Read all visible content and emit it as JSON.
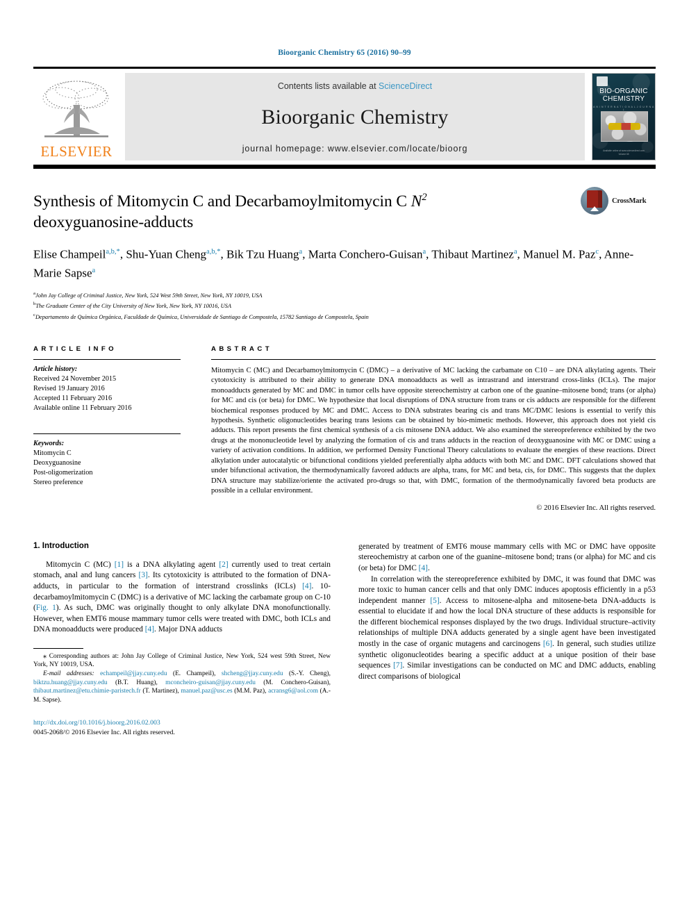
{
  "running_head": "Bioorganic Chemistry 65 (2016) 90–99",
  "masthead": {
    "publisher_logo_label": "ELSEVIER",
    "contents_prefix": "Contents lists available at ",
    "contents_link": "ScienceDirect",
    "journal_title": "Bioorganic Chemistry",
    "homepage_label": "journal homepage: www.elsevier.com/locate/bioorg",
    "cover": {
      "title_line1": "BIO-ORGANIC",
      "title_line2": "CHEMISTRY",
      "subtitle": "A N   I N T E R N A T I O N A L   J O U R N A L",
      "footer_line1": "Available online at www.sciencedirect.com",
      "footer_line2": "Volume 65"
    }
  },
  "article": {
    "title_part1": "Synthesis of Mitomycin C and Decarbamoylmitomycin C ",
    "title_italic": "N",
    "title_sup": "2",
    "title_part2": "deoxyguanosine-adducts",
    "crossmark_label": "CrossMark",
    "authors_line1_a": "Elise Champeil",
    "authors_line1_a_sup": "a,b,*",
    "authors_line1_b": ", Shu-Yuan Cheng",
    "authors_line1_b_sup": "a,b,*",
    "authors_line1_c": ", Bik Tzu Huang",
    "authors_line1_c_sup": "a",
    "authors_line1_d": ", Marta Conchero-Guisan",
    "authors_line1_d_sup": "a",
    "authors_line1_e": ", Thibaut Martinez",
    "authors_line1_e_sup": "a",
    "authors_line2_a": ", Manuel M. Paz",
    "authors_line2_a_sup": "c",
    "authors_line2_b": ", Anne-Marie Sapse",
    "authors_line2_b_sup": "a",
    "affiliations": [
      {
        "marker": "a",
        "text": "John Jay College of Criminal Justice, New York, 524 West 59th Street, New York, NY 10019, USA"
      },
      {
        "marker": "b",
        "text": "The Graduate Center of the City University of New York, New York, NY 10016, USA"
      },
      {
        "marker": "c",
        "text": "Departamento de Química Orgánica, Faculdade de Química, Universidade de Santiago de Compostela, 15782 Santiago de Compostela, Spain"
      }
    ]
  },
  "article_info": {
    "heading": "ARTICLE INFO",
    "history_label": "Article history:",
    "history": [
      "Received 24 November 2015",
      "Revised 19 January 2016",
      "Accepted 11 February 2016",
      "Available online 11 February 2016"
    ],
    "keywords_label": "Keywords:",
    "keywords": [
      "Mitomycin C",
      "Deoxyguanosine",
      "Post-oligomerization",
      "Stereo preference"
    ]
  },
  "abstract": {
    "heading": "ABSTRACT",
    "text": "Mitomycin C (MC) and Decarbamoylmitomycin C (DMC) – a derivative of MC lacking the carbamate on C10 – are DNA alkylating agents. Their cytotoxicity is attributed to their ability to generate DNA monoadducts as well as intrastrand and interstrand cross-links (ICLs). The major monoadducts generated by MC and DMC in tumor cells have opposite stereochemistry at carbon one of the guanine–mitosene bond; trans (or alpha) for MC and cis (or beta) for DMC. We hypothesize that local disruptions of DNA structure from trans or cis adducts are responsible for the different biochemical responses produced by MC and DMC. Access to DNA substrates bearing cis and trans MC/DMC lesions is essential to verify this hypothesis. Synthetic oligonucleotides bearing trans lesions can be obtained by bio-mimetic methods. However, this approach does not yield cis adducts. This report presents the first chemical synthesis of a cis mitosene DNA adduct. We also examined the stereopreference exhibited by the two drugs at the mononucleotide level by analyzing the formation of cis and trans adducts in the reaction of deoxyguanosine with MC or DMC using a variety of activation conditions. In addition, we performed Density Functional Theory calculations to evaluate the energies of these reactions. Direct alkylation under autocatalytic or bifunctional conditions yielded preferentially alpha adducts with both MC and DMC. DFT calculations showed that under bifunctional activation, the thermodynamically favored adducts are alpha, trans, for MC and beta, cis, for DMC. This suggests that the duplex DNA structure may stabilize/oriente the activated pro-drugs so that, with DMC, formation of the thermodynamically favored beta products are possible in a cellular environment.",
    "copyright": "© 2016 Elsevier Inc. All rights reserved."
  },
  "introduction": {
    "section_title": "1. Introduction",
    "left": {
      "p1_s1": "Mitomycin C (MC) ",
      "p1_r1": "[1]",
      "p1_s2": " is a DNA alkylating agent ",
      "p1_r2": "[2]",
      "p1_s3": " currently used to treat certain stomach, anal and lung cancers ",
      "p1_r3": "[3]",
      "p1_s4": ". Its cytotoxicity is attributed to the formation of DNA-adducts, in particular to the formation of interstrand crosslinks (ICLs) ",
      "p1_r4": "[4]",
      "p1_s5": ". 10-decarbamoylmitomycin C (DMC) is a derivative of MC lacking the carbamate group on C-10 (",
      "p1_r5": "Fig. 1",
      "p1_s6": "). As such, DMC was originally thought to only alkylate DNA monofunctionally. However, when EMT6 mouse mammary tumor cells were treated with DMC, both ICLs and DNA monoadducts were produced ",
      "p1_r6": "[4]",
      "p1_s7": ". Major DNA adducts"
    },
    "right": {
      "p1_cont": "generated by treatment of EMT6 mouse mammary cells with MC or DMC have opposite stereochemistry at carbon one of the guanine–mitosene bond; trans (or alpha) for MC and cis (or beta) for DMC ",
      "p1_r1": "[4]",
      "p1_end": ".",
      "p2_s1": "In correlation with the stereopreference exhibited by DMC, it was found that DMC was more toxic to human cancer cells and that only DMC induces apoptosis efficiently in a p53 independent manner ",
      "p2_r1": "[5]",
      "p2_s2": ". Access to mitosene-alpha and mitosene-beta DNA-adducts is essential to elucidate if and how the local DNA structure of these adducts is responsible for the different biochemical responses displayed by the two drugs. Individual structure–activity relationships of multiple DNA adducts generated by a single agent have been investigated mostly in the case of organic mutagens and carcinogens ",
      "p2_r2": "[6]",
      "p2_s3": ". In general, such studies utilize synthetic oligonucleotides bearing a specific adduct at a unique position of their base sequences ",
      "p2_r3": "[7]",
      "p2_s4": ". Similar investigations can be conducted on MC and DMC adducts, enabling direct comparisons of biological"
    }
  },
  "footnotes": {
    "corresponding_star": "⁎",
    "corresponding_text": " Corresponding authors at: John Jay College of Criminal Justice, New York, 524 west 59th Street, New York, NY 10019, USA.",
    "email_label": "E-mail addresses:",
    "emails": [
      {
        "address": "echampeil@jjay.cuny.edu",
        "person": " (E. Champeil), "
      },
      {
        "address": "shcheng@jjay.cuny.edu",
        "person": " (S.-Y. Cheng), "
      },
      {
        "address": "biktzu.huang@jjay.cuny.edu",
        "person": " (B.T. Huang), "
      },
      {
        "address": "mconcheiro-guisan@jjay.cuny.edu",
        "person": " (M. Conchero-Guisan), "
      },
      {
        "address": "thibaut.martinez@etu.chimie-paristech.fr",
        "person": " (T. Martinez), "
      },
      {
        "address": "manuel.paz@usc.es",
        "person": " (M.M. Paz), "
      },
      {
        "address": "acransg6@aol.com",
        "person": " (A.-M. Sapse)."
      }
    ],
    "doi": "http://dx.doi.org/10.1016/j.bioorg.2016.02.003",
    "issn_line": "0045-2068/© 2016 Elsevier Inc. All rights reserved."
  },
  "colors": {
    "link_blue": "#1a7fae",
    "sciencedirect_blue": "#3c97c4",
    "elsevier_orange": "#F08019",
    "band_gray": "#e6e6e6",
    "crossmark_red": "#9a2219"
  }
}
